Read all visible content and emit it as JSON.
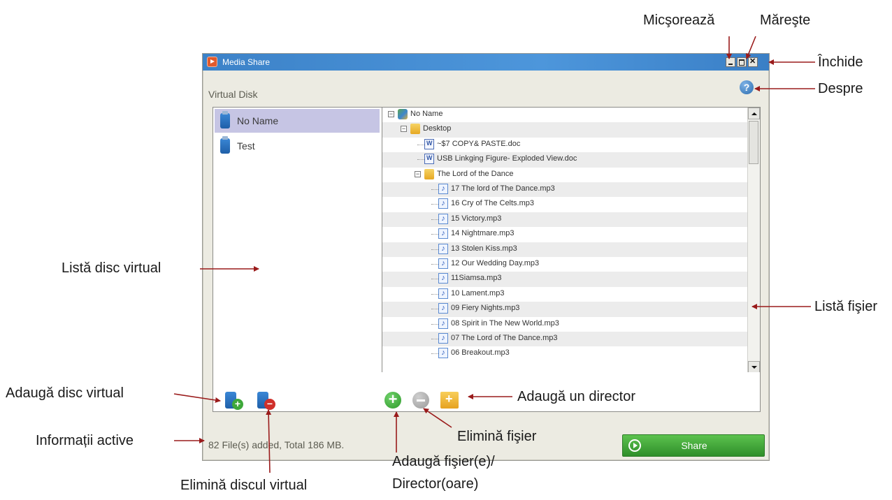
{
  "window": {
    "title": "Media Share",
    "section_label": "Virtual Disk",
    "status": "82 File(s) added, Total 186 MB.",
    "share_label": "Share"
  },
  "disk_list": [
    {
      "label": "No Name",
      "selected": true
    },
    {
      "label": "Test",
      "selected": false
    }
  ],
  "file_tree": [
    {
      "label": "No Name",
      "type": "network",
      "depth": 0
    },
    {
      "label": "Desktop",
      "type": "folder",
      "depth": 1
    },
    {
      "label": "~$7 COPY& PASTE.doc",
      "type": "doc",
      "depth": 2
    },
    {
      "label": "USB Linkging Figure- Exploded View.doc",
      "type": "doc",
      "depth": 2
    },
    {
      "label": "The Lord of the Dance",
      "type": "folder",
      "depth": 2
    },
    {
      "label": "17 The lord of The Dance.mp3",
      "type": "music",
      "depth": 3
    },
    {
      "label": "16 Cry of The Celts.mp3",
      "type": "music",
      "depth": 3
    },
    {
      "label": "15 Victory.mp3",
      "type": "music",
      "depth": 3
    },
    {
      "label": "14 Nightmare.mp3",
      "type": "music",
      "depth": 3
    },
    {
      "label": "13 Stolen Kiss.mp3",
      "type": "music",
      "depth": 3
    },
    {
      "label": "12 Our Wedding Day.mp3",
      "type": "music",
      "depth": 3
    },
    {
      "label": "11Siamsa.mp3",
      "type": "music",
      "depth": 3
    },
    {
      "label": "10 Lament.mp3",
      "type": "music",
      "depth": 3
    },
    {
      "label": "09 Fiery Nights.mp3",
      "type": "music",
      "depth": 3
    },
    {
      "label": "08 Spirit in The New World.mp3",
      "type": "music",
      "depth": 3
    },
    {
      "label": "07 The Lord of The Dance.mp3",
      "type": "music",
      "depth": 3
    },
    {
      "label": "06 Breakout.mp3",
      "type": "music",
      "depth": 3
    }
  ],
  "callouts": {
    "micsoreaza": "Micşorează",
    "mareste": "Măreşte",
    "inchide": "Închide",
    "despre": "Despre",
    "lista_disc": "Listă disc virtual",
    "lista_fisier": "Listă fişier",
    "adauga_disc": "Adaugă disc virtual",
    "informatii": "Informații active",
    "elimina_disc": "Elimină discul virtual",
    "adauga_director": "Adaugă un director",
    "elimina_fisier": "Elimină fişier",
    "adauga_fisier_1": "Adaugă fişier(e)/",
    "adauga_fisier_2": "Director(oare)"
  }
}
